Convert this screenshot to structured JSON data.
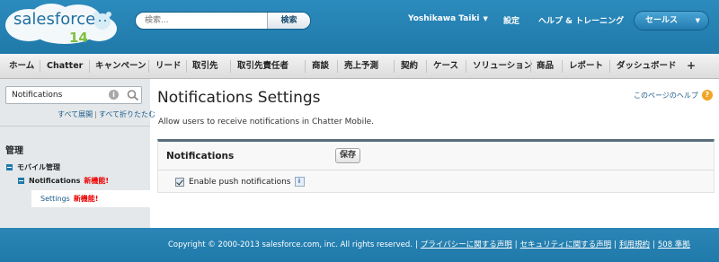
{
  "header": {
    "logo_text": "salesforce",
    "logo_release": "14",
    "search_placeholder": "検索...",
    "search_button": "検索",
    "user_name": "Yoshikawa Taiki",
    "settings_link": "設定",
    "help_link": "ヘルプ & トレーニング",
    "app_menu_label": "セールス"
  },
  "tabs": [
    "ホーム",
    "Chatter",
    "キャンペーン",
    "リード",
    "取引先",
    "取引先責任者",
    "商談",
    "売上予測",
    "契約",
    "ケース",
    "ソリューション",
    "商品",
    "レポート",
    "ダッシュボード"
  ],
  "tab_plus": "+",
  "sidebar": {
    "search_value": "Notifications",
    "expand_all": "すべて展開",
    "collapse_all": "すべて折りたたむ",
    "section_title": "管理",
    "tree": {
      "level1_label": "モバイル管理",
      "level1_badge": "新機能!",
      "level2_label": "Notifications",
      "level2_badge": "新機能!",
      "level3_label": "Settings",
      "level3_badge": "新機能!"
    }
  },
  "main": {
    "title": "Notifications Settings",
    "help_link": "このページのヘルプ",
    "description": "Allow users to receive notifications in Chatter Mobile.",
    "panel_title": "Notifications",
    "save_button": "保存",
    "checkbox_label": "Enable push notifications",
    "checkbox_checked": true
  },
  "footer": {
    "copyright": "Copyright © 2000-2013 salesforce.com, inc. All rights reserved.",
    "links": [
      "プライバシーに関する声明",
      "セキュリティに関する声明",
      "利用規約",
      "508 準拠"
    ]
  },
  "colors": {
    "header_blue": "#1f79a9",
    "badge_red": "#e00000",
    "help_orange": "#f2a524"
  }
}
